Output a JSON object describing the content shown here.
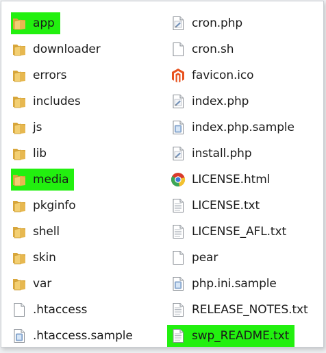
{
  "colors": {
    "highlight": "#22f00f",
    "folder_back": "#d9a73b",
    "folder_front": "#f3cf72",
    "magento_orange": "#e8521f"
  },
  "left_column": [
    {
      "label": "app",
      "icon": "folder-icon",
      "highlighted": true
    },
    {
      "label": "downloader",
      "icon": "folder-icon",
      "highlighted": false
    },
    {
      "label": "errors",
      "icon": "folder-icon",
      "highlighted": false
    },
    {
      "label": "includes",
      "icon": "folder-icon",
      "highlighted": false
    },
    {
      "label": "js",
      "icon": "folder-icon",
      "highlighted": false
    },
    {
      "label": "lib",
      "icon": "folder-icon",
      "highlighted": false
    },
    {
      "label": "media",
      "icon": "folder-icon",
      "highlighted": true
    },
    {
      "label": "pkginfo",
      "icon": "folder-icon",
      "highlighted": false
    },
    {
      "label": "shell",
      "icon": "folder-icon",
      "highlighted": false
    },
    {
      "label": "skin",
      "icon": "folder-icon",
      "highlighted": false
    },
    {
      "label": "var",
      "icon": "folder-icon",
      "highlighted": false
    },
    {
      "label": ".htaccess",
      "icon": "blank-file-icon",
      "highlighted": false
    },
    {
      "label": ".htaccess.sample",
      "icon": "sample-file-icon",
      "highlighted": false
    }
  ],
  "right_column": [
    {
      "label": "cron.php",
      "icon": "php-file-icon",
      "highlighted": false
    },
    {
      "label": "cron.sh",
      "icon": "blank-file-icon",
      "highlighted": false
    },
    {
      "label": "favicon.ico",
      "icon": "magento-icon",
      "highlighted": false
    },
    {
      "label": "index.php",
      "icon": "php-file-icon",
      "highlighted": false
    },
    {
      "label": "index.php.sample",
      "icon": "sample-file-icon",
      "highlighted": false
    },
    {
      "label": "install.php",
      "icon": "php-file-icon",
      "highlighted": false
    },
    {
      "label": "LICENSE.html",
      "icon": "chrome-icon",
      "highlighted": false
    },
    {
      "label": "LICENSE.txt",
      "icon": "text-file-icon",
      "highlighted": false
    },
    {
      "label": "LICENSE_AFL.txt",
      "icon": "text-file-icon",
      "highlighted": false
    },
    {
      "label": "pear",
      "icon": "blank-file-icon",
      "highlighted": false
    },
    {
      "label": "php.ini.sample",
      "icon": "sample-file-icon",
      "highlighted": false
    },
    {
      "label": "RELEASE_NOTES.txt",
      "icon": "text-file-icon",
      "highlighted": false
    },
    {
      "label": "swp_README.txt",
      "icon": "text-file-icon",
      "highlighted": true
    }
  ]
}
